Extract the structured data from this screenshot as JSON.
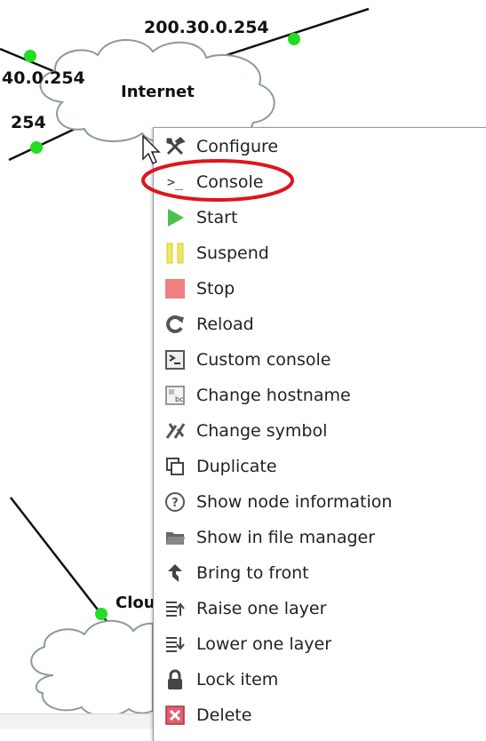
{
  "topology": {
    "cloud_internet_label": "Internet",
    "cloud_bottom_label": "Clou",
    "address_top": "200.30.0.254",
    "address_left_top": "40.0.254",
    "address_left_bottom": "254"
  },
  "context_menu": {
    "items": [
      {
        "label": "Configure",
        "icon": "wrench-screwdriver-icon"
      },
      {
        "label": "Console",
        "icon": "terminal-prompt-icon"
      },
      {
        "label": "Start",
        "icon": "play-icon"
      },
      {
        "label": "Suspend",
        "icon": "pause-icon"
      },
      {
        "label": "Stop",
        "icon": "stop-icon"
      },
      {
        "label": "Reload",
        "icon": "reload-icon"
      },
      {
        "label": "Custom console",
        "icon": "custom-console-icon"
      },
      {
        "label": "Change hostname",
        "icon": "hostname-icon"
      },
      {
        "label": "Change symbol",
        "icon": "symbol-icon"
      },
      {
        "label": "Duplicate",
        "icon": "duplicate-icon"
      },
      {
        "label": "Show node information",
        "icon": "info-icon"
      },
      {
        "label": "Show in file manager",
        "icon": "folder-icon"
      },
      {
        "label": "Bring to front",
        "icon": "bring-front-icon"
      },
      {
        "label": "Raise one layer",
        "icon": "raise-layer-icon"
      },
      {
        "label": "Lower one layer",
        "icon": "lower-layer-icon"
      },
      {
        "label": "Lock item",
        "icon": "lock-icon"
      },
      {
        "label": "Delete",
        "icon": "delete-icon"
      }
    ]
  },
  "colors": {
    "link_endpoint": "#22dd22",
    "highlight_ring": "#e0141e",
    "start": "#4cc24c",
    "suspend": "#f2e65a",
    "stop": "#f08080",
    "cloud_stroke": "#8a9aa0"
  }
}
